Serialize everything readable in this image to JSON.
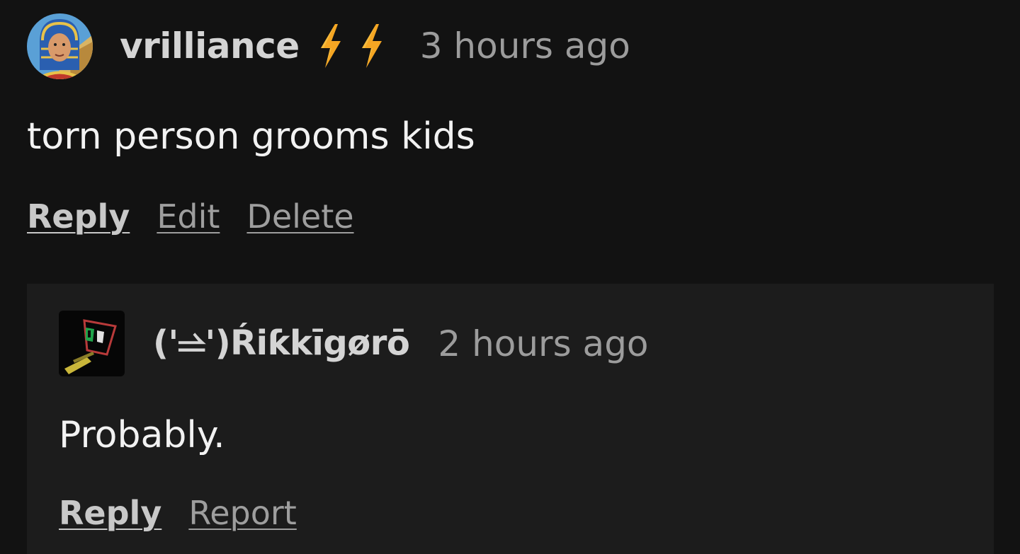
{
  "comment": {
    "avatar_icon": "pharaoh-avatar-icon",
    "username": "vrilliance",
    "badges": [
      "lightning-bolt-icon",
      "lightning-bolt-icon"
    ],
    "timestamp": "3 hours ago",
    "body": "torn person grooms kids",
    "actions": {
      "reply": "Reply",
      "edit": "Edit",
      "delete": "Delete"
    }
  },
  "reply": {
    "avatar_icon": "glitch-face-avatar-icon",
    "username": "('⥬')Ŕiƙkīgørō",
    "timestamp": "2 hours ago",
    "body": "Probably.",
    "actions": {
      "reply": "Reply",
      "report": "Report"
    }
  },
  "colors": {
    "background": "#121212",
    "reply_background": "#1c1c1c",
    "bolt": "#f5a623"
  }
}
